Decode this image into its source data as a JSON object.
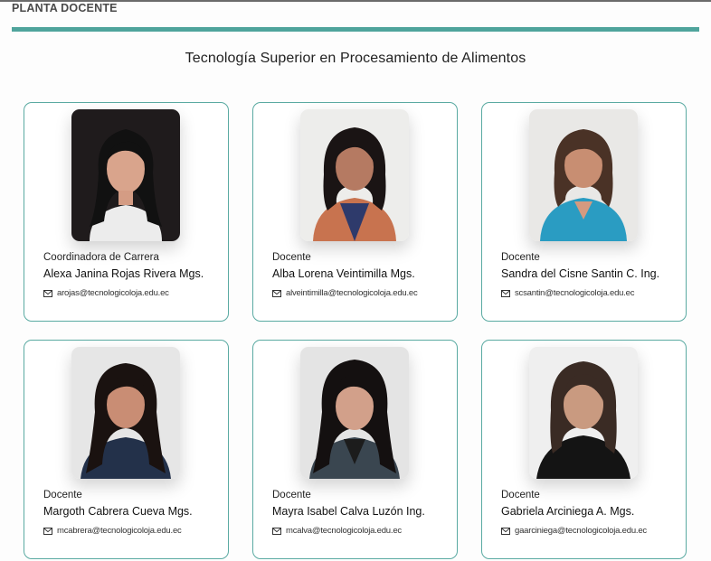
{
  "header": {
    "section_title": "PLANTA DOCENTE",
    "program_title": "Tecnología Superior en Procesamiento de Alimentos"
  },
  "colors": {
    "accent": "#4fa49c",
    "card_border": "#5aaaa2"
  },
  "staff": [
    {
      "role": "Coordinadora de Carrera",
      "name": "Alexa Janina Rojas Rivera Mgs.",
      "email": "arojas@tecnologicoloja.edu.ec",
      "email_icon": "envelope-icon"
    },
    {
      "role": "Docente",
      "name": "Alba Lorena Veintimilla Mgs.",
      "email": "alveintimilla@tecnologicoloja.edu.ec",
      "email_icon": "envelope-icon"
    },
    {
      "role": "Docente",
      "name": "Sandra del Cisne Santin C. Ing.",
      "email": "scsantin@tecnologicoloja.edu.ec",
      "email_icon": "envelope-icon"
    },
    {
      "role": "Docente",
      "name": "Margoth Cabrera Cueva Mgs.",
      "email": "mcabrera@tecnologicoloja.edu.ec",
      "email_icon": "envelope-icon"
    },
    {
      "role": "Docente",
      "name": "Mayra Isabel Calva Luzón Ing.",
      "email": "mcalva@tecnologicoloja.edu.ec",
      "email_icon": "envelope-icon"
    },
    {
      "role": "Docente",
      "name": "Gabriela Arciniega A. Mgs.",
      "email": "gaarciniega@tecnologicoloja.edu.ec",
      "email_icon": "envelope-icon"
    }
  ]
}
